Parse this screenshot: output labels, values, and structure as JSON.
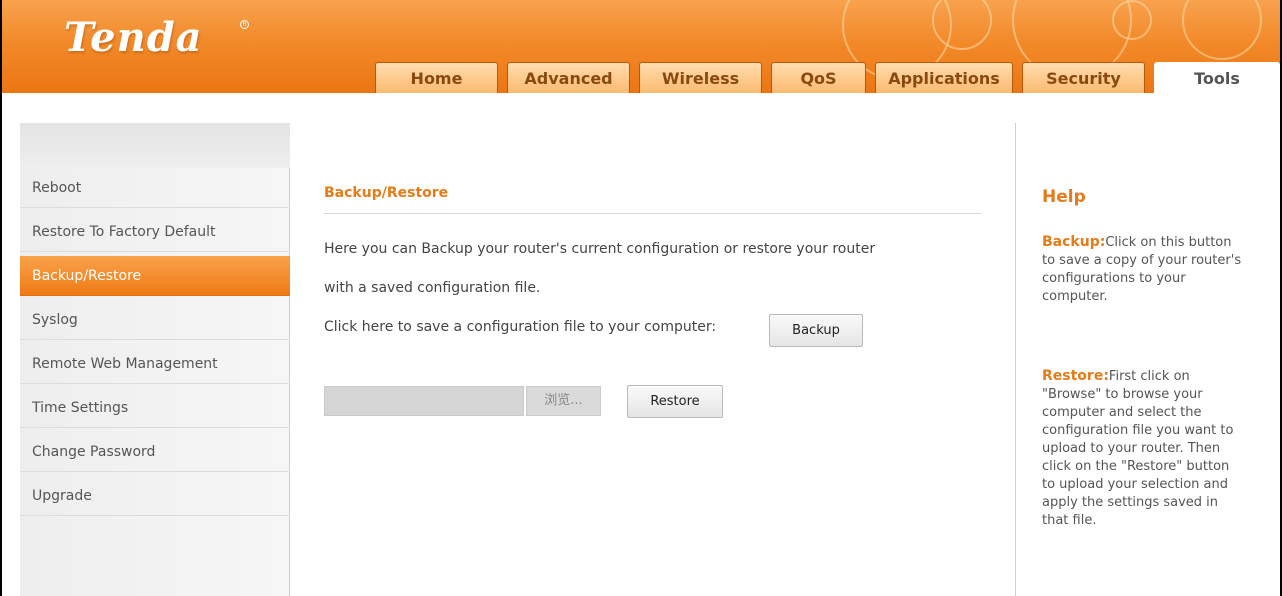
{
  "app": {
    "logo": "Tenda",
    "logo_mark": "R"
  },
  "tabs": [
    {
      "label": "Home"
    },
    {
      "label": "Advanced"
    },
    {
      "label": "Wireless"
    },
    {
      "label": "QoS"
    },
    {
      "label": "Applications"
    },
    {
      "label": "Security"
    },
    {
      "label": "Tools"
    }
  ],
  "active_tab": "Tools",
  "sidebar": {
    "items": [
      {
        "label": "Reboot"
      },
      {
        "label": "Restore To Factory Default"
      },
      {
        "label": "Backup/Restore"
      },
      {
        "label": "Syslog"
      },
      {
        "label": "Remote Web Management"
      },
      {
        "label": "Time Settings"
      },
      {
        "label": "Change Password"
      },
      {
        "label": "Upgrade"
      }
    ],
    "active": "Backup/Restore"
  },
  "main": {
    "title": "Backup/Restore",
    "intro_line1": "Here you can Backup your router's current configuration or restore your router",
    "intro_line2": "with a saved configuration file.",
    "backup_prompt": "Click here to save a configuration file to your computer:",
    "backup_button": "Backup",
    "file_input_value": "",
    "browse_button": "浏览...",
    "restore_button": "Restore"
  },
  "help": {
    "title": "Help",
    "backup_key": "Backup:",
    "backup_text": "Click on this button to save a copy of your router's configurations to your computer.",
    "restore_key": "Restore:",
    "restore_text": "First click on \"Browse\" to browse your computer and select the configuration file you want to upload to your router. Then click on the \"Restore\" button to upload your selection and apply the settings saved in that file."
  },
  "colors": {
    "accent": "#ef7a16",
    "header_gradient_top": "#f8a24e",
    "title_orange": "#e67b17"
  }
}
